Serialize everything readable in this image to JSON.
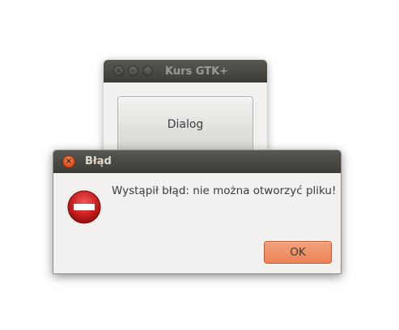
{
  "main_window": {
    "title": "Kurs GTK+",
    "dialog_button_label": "Dialog"
  },
  "error_dialog": {
    "title": "Błąd",
    "message": "Wystąpił błąd: nie można otworzyć pliku!",
    "ok_label": "OK",
    "icon": "error-icon"
  },
  "colors": {
    "titlebar": "#3c3b37",
    "window_bg": "#f2f1f0",
    "accent_close": "#dd4814",
    "ok_button": "#ea8556",
    "error_icon": "#cc1f1f"
  }
}
